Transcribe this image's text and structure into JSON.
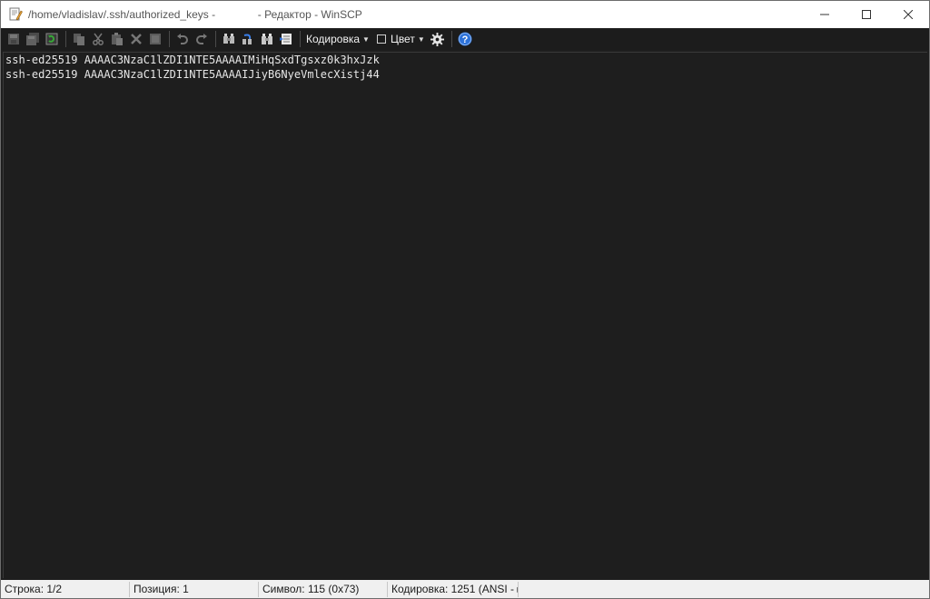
{
  "window": {
    "title": "/home/vladislav/.ssh/authorized_keys -              - Редактор - WinSCP",
    "controls": [
      "minimize",
      "maximize",
      "close"
    ]
  },
  "toolbar": {
    "buttons": [
      "save-icon",
      "save-all-icon",
      "reload-icon",
      "copy-icon",
      "cut-icon",
      "paste-icon",
      "delete-icon",
      "select-all-icon",
      "undo-icon",
      "redo-icon",
      "find-icon",
      "replace-icon",
      "find-next-icon",
      "goto-line-icon"
    ],
    "encoding_label": "Кодировка",
    "color_label": "Цвет",
    "settings_icon": "gear-icon",
    "help_icon": "help-icon"
  },
  "editor": {
    "lines": [
      "ssh-ed25519 AAAAC3NzaC1lZDI1NTE5AAAAIMiHqSxdTgsxz0k3hxJzk",
      "ssh-ed25519 AAAAC3NzaC1lZDI1NTE5AAAAIJiyB6NyeVmlecXistj44"
    ]
  },
  "status": {
    "line": "Строка: 1/2",
    "position": "Позиция: 1",
    "symbol": "Символ: 115 (0x73)",
    "encoding": "Кодировка: 1251  (ANSI - ▸"
  },
  "colors": {
    "editor_bg": "#1e1e1e",
    "editor_text": "#e6e6e6",
    "toolbar_bg": "#1c1c1c",
    "statusbar_bg": "#f0f0f0"
  }
}
